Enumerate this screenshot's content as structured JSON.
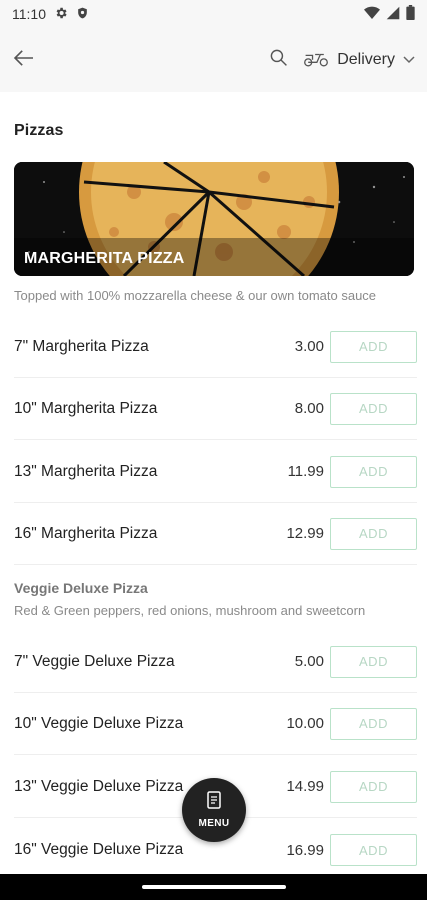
{
  "status_bar": {
    "time": "11:10",
    "icons": [
      "gear-icon",
      "shield-icon",
      "wifi-icon",
      "signal-icon",
      "battery-icon"
    ]
  },
  "header": {
    "delivery_label": "Delivery",
    "icons": [
      "back-arrow-icon",
      "search-icon",
      "scooter-icon",
      "chevron-down-icon"
    ]
  },
  "section_title": "Pizzas",
  "banner": {
    "title": "MARGHERITA PIZZA"
  },
  "margherita": {
    "description": "Topped with 100% mozzarella cheese & our own tomato sauce",
    "items": [
      {
        "name": "7\" Margherita Pizza",
        "price": "3.00",
        "button": "ADD"
      },
      {
        "name": "10\" Margherita Pizza",
        "price": "8.00",
        "button": "ADD"
      },
      {
        "name": "13\" Margherita Pizza",
        "price": "11.99",
        "button": "ADD"
      },
      {
        "name": "16\" Margherita Pizza",
        "price": "12.99",
        "button": "ADD"
      }
    ]
  },
  "veggie": {
    "title": "Veggie Deluxe Pizza",
    "description": "Red & Green peppers, red onions, mushroom and sweetcorn",
    "items": [
      {
        "name": "7\" Veggie Deluxe Pizza",
        "price": "5.00",
        "button": "ADD"
      },
      {
        "name": "10\" Veggie Deluxe Pizza",
        "price": "10.00",
        "button": "ADD"
      },
      {
        "name": "13\" Veggie Deluxe Pizza",
        "price": "14.99",
        "button": "ADD"
      },
      {
        "name": "16\" Veggie Deluxe Pizza",
        "price": "16.99",
        "button": "ADD"
      }
    ]
  },
  "fab": {
    "label": "MENU"
  },
  "colors": {
    "add_border": "#b9e2c9",
    "add_text": "#b7d7c4",
    "fab_bg": "#222222",
    "header_bg": "#f7f7f7"
  }
}
